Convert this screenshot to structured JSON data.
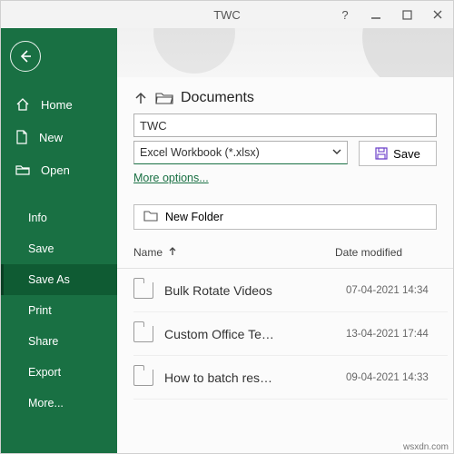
{
  "titlebar": {
    "title": "TWC"
  },
  "sidebar": {
    "top": [
      {
        "label": "Home"
      },
      {
        "label": "New"
      },
      {
        "label": "Open"
      }
    ],
    "sub": [
      {
        "label": "Info"
      },
      {
        "label": "Save"
      },
      {
        "label": "Save As",
        "active": true
      },
      {
        "label": "Print"
      },
      {
        "label": "Share"
      },
      {
        "label": "Export"
      },
      {
        "label": "More..."
      }
    ]
  },
  "save": {
    "location": "Documents",
    "filename": "TWC",
    "filetype_selected": "Excel Workbook (*.xlsx)",
    "save_label": "Save",
    "more_label": "More options...",
    "new_folder_label": "New Folder"
  },
  "list": {
    "col_name": "Name",
    "col_date": "Date modified",
    "rows": [
      {
        "name": "Bulk Rotate Videos",
        "date": "07-04-2021 14:34"
      },
      {
        "name": "Custom Office Te…",
        "date": "13-04-2021 17:44"
      },
      {
        "name": "How to batch res…",
        "date": "09-04-2021 14:33"
      }
    ]
  },
  "watermark": "wsxdn.com"
}
